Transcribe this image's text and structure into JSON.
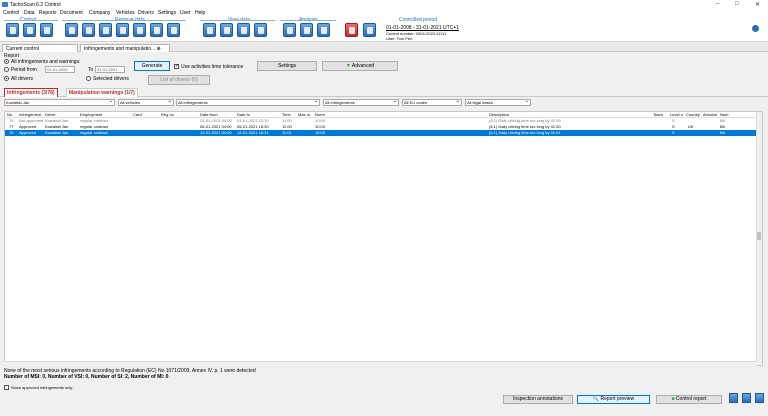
{
  "app": {
    "title": "TachoScan 6.2 Control",
    "min": "–",
    "max": "□",
    "close": "✕"
  },
  "menu": [
    "Control",
    "Data",
    "Reports",
    "Document",
    "Company",
    "Vehicles",
    "Drivers",
    "Settings",
    "User",
    "Help"
  ],
  "ribbon": {
    "groups": [
      "Control",
      "Retrieve data",
      "View data",
      "Analysis",
      "Controlled period"
    ]
  },
  "period": {
    "range": "01-01-2008 - 31-01-2021 UTC+1",
    "control_number": "Control number: 0004-2020-11111",
    "user": "User: Tom Pen"
  },
  "tabs": [
    "Current control",
    "Infringements and manipulatio..."
  ],
  "report": {
    "title": "Report",
    "opt_all": "All infringements and warnings:",
    "opt_period": "Period from",
    "from": "01-01-2008",
    "to_label": "To",
    "to": "31-01-2021",
    "opt_all_drivers": "All drivers",
    "opt_selected_drivers": "Selected drivers",
    "generate": "Generate",
    "tolerance": "Use activities time tolerance",
    "settings": "Settings",
    "advanced": "Advanced",
    "list_drivers": "List of drivers (0)"
  },
  "subtabs": [
    "Infringements (3/78)",
    "Manipulation warnings (1/7)"
  ],
  "filters": [
    "Kowalski Jan",
    "All vehicles",
    "All infringements",
    "All infringements",
    "All EU codes",
    "All legal bases"
  ],
  "grid": {
    "headers": [
      "No",
      "Infringement",
      "Driver",
      "Employment",
      "Card",
      "Reg no",
      "Date from",
      "Date to",
      "Time",
      "Max ro",
      "Norm",
      "Description",
      "Team",
      "Level o",
      "Country",
      "Annotat",
      "Num"
    ],
    "rows": [
      {
        "no": "76",
        "inf": "Not approved",
        "driver": "Kowalski Jan",
        "emp": "regular contract",
        "from": "01-01-2021 04:00",
        "to": "01-01-2021 15:30",
        "time": "11:00",
        "max": "",
        "norm": "10:00",
        "desc": "(6.1) Daily driving time too long by 01:00",
        "level": "S",
        "country": "",
        "num": "B6"
      },
      {
        "no": "77",
        "inf": "Approved",
        "driver": "Kowalski Jan",
        "emp": "regular contract",
        "from": "06-01-2021 04:00",
        "to": "06-01-2021 16:30",
        "time": "11:00",
        "max": "",
        "norm": "10:00",
        "desc": "(6.1) Daily driving time too long by 01:00",
        "level": "S",
        "country": "UK",
        "num": "B6"
      },
      {
        "no": "78",
        "inf": "Approved",
        "driver": "Kowalski Jan",
        "emp": "regular contract",
        "from": "12-01-2021 04:00",
        "to": "12-01-2021 16:31",
        "time": "11:01",
        "max": "",
        "norm": "10:00",
        "desc": "(6.1) Daily driving time too long by 01:01",
        "level": "S",
        "country": "",
        "num": "B6"
      }
    ]
  },
  "footer": {
    "line1": "None of the most serious infringements according to Regulation (EC) No 1071/2009, Annex IV, p. 1 were detected",
    "line2": "Number of MSI: 0, Number of VSI: 0, Number of SI: 2, Number of MI: 0",
    "show_approved": "Show approved infringements only"
  },
  "bottom": {
    "inspection": "Inspection annotations",
    "preview": "Report preview",
    "control_report": "Control report"
  }
}
